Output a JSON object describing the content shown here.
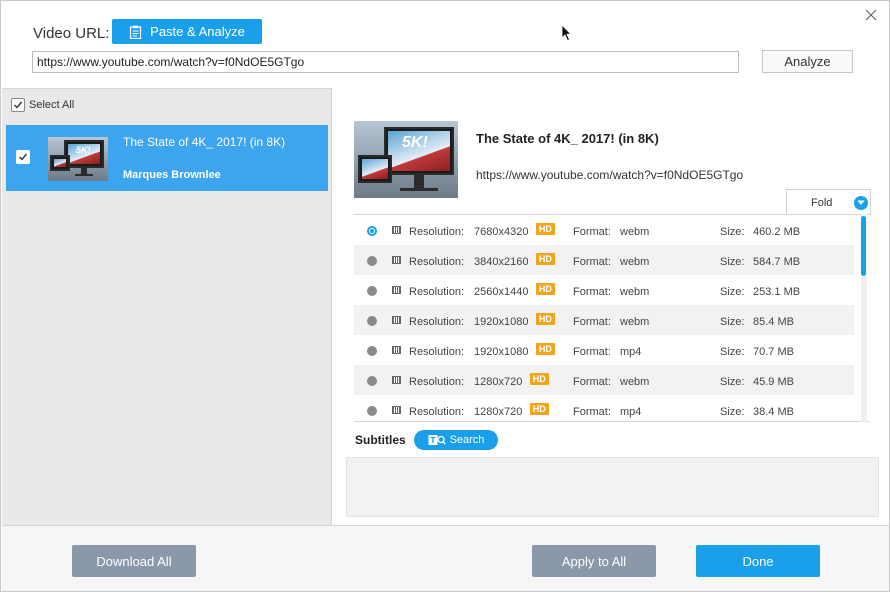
{
  "header": {
    "url_label": "Video URL:",
    "paste_analyze_label": "Paste & Analyze",
    "url_value": "https://www.youtube.com/watch?v=f0NdOE5GTgo",
    "analyze_label": "Analyze"
  },
  "sidebar": {
    "select_all_label": "Select All",
    "items": [
      {
        "title": "The State of 4K_ 2017! (in 8K)",
        "author": "Marques Brownlee",
        "thumb_text": "5K!"
      }
    ]
  },
  "detail": {
    "title": "The State of 4K_ 2017! (in 8K)",
    "url": "https://www.youtube.com/watch?v=f0NdOE5GTgo",
    "fold_label": "Fold",
    "thumb_text": "5K!",
    "resolution_label": "Resolution:",
    "format_label": "Format:",
    "size_label": "Size:",
    "hd_badge": "HD",
    "formats": [
      {
        "resolution": "7680x4320",
        "format": "webm",
        "size": "460.2 MB",
        "selected": true
      },
      {
        "resolution": "3840x2160",
        "format": "webm",
        "size": "584.7 MB",
        "selected": false
      },
      {
        "resolution": "2560x1440",
        "format": "webm",
        "size": "253.1 MB",
        "selected": false
      },
      {
        "resolution": "1920x1080",
        "format": "webm",
        "size": "85.4 MB",
        "selected": false
      },
      {
        "resolution": "1920x1080",
        "format": "mp4",
        "size": "70.7 MB",
        "selected": false
      },
      {
        "resolution": "1280x720",
        "format": "webm",
        "size": "45.9 MB",
        "selected": false
      },
      {
        "resolution": "1280x720",
        "format": "mp4",
        "size": "38.4 MB",
        "selected": false
      }
    ],
    "subtitles_label": "Subtitles",
    "search_label": "Search"
  },
  "footer": {
    "download_all_label": "Download All",
    "apply_all_label": "Apply to All",
    "done_label": "Done"
  },
  "colors": {
    "accent": "#1aa0ea",
    "selected_item": "#3da5ef",
    "hd_badge": "#f2a51b",
    "gray_button": "#8b98aa"
  }
}
